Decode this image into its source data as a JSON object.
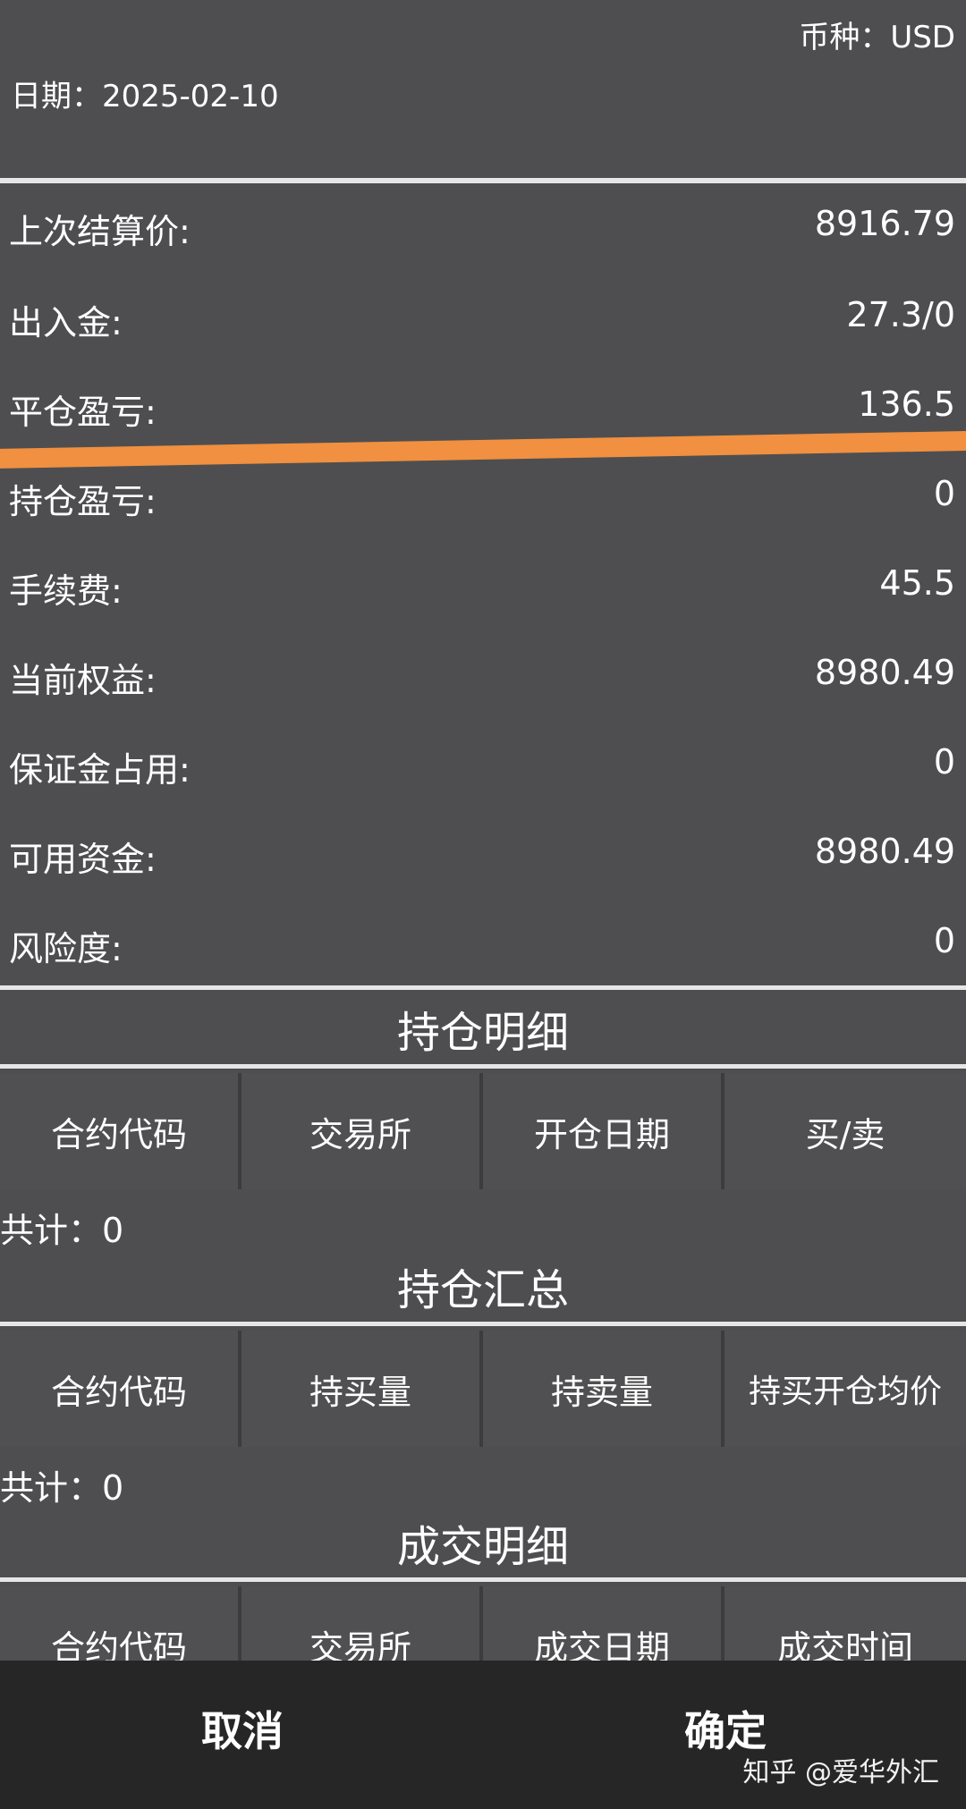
{
  "header": {
    "currency": "币种：USD",
    "date": "日期：2025-02-10"
  },
  "summary": [
    {
      "label": "上次结算价:",
      "value": "8916.79"
    },
    {
      "label": "出入金:",
      "value": "27.3/0"
    },
    {
      "label": "平仓盈亏:",
      "value": "136.5"
    },
    {
      "label": "持仓盈亏:",
      "value": "0"
    },
    {
      "label": "手续费:",
      "value": "45.5"
    },
    {
      "label": "当前权益:",
      "value": "8980.49"
    },
    {
      "label": "保证金占用:",
      "value": "0"
    },
    {
      "label": "可用资金:",
      "value": "8980.49"
    },
    {
      "label": "风险度:",
      "value": "0"
    }
  ],
  "positions_detail": {
    "title": "持仓明细",
    "columns": [
      "合约代码",
      "交易所",
      "开仓日期",
      "买/卖"
    ],
    "total": "共计：0"
  },
  "positions_summary": {
    "title": "持仓汇总",
    "columns": [
      "合约代码",
      "持买量",
      "持卖量",
      "持买开仓均价"
    ],
    "total": "共计：0"
  },
  "trades_detail": {
    "title": "成交明细",
    "columns": [
      "合约代码",
      "交易所",
      "成交日期",
      "成交时间"
    ]
  },
  "actions": {
    "cancel": "取消",
    "confirm": "确定"
  },
  "watermark": "知乎 @爱华外汇",
  "colors": {
    "background": "#4e4e50",
    "bottom_bar": "#262626",
    "highlight_line": "#f09040"
  }
}
